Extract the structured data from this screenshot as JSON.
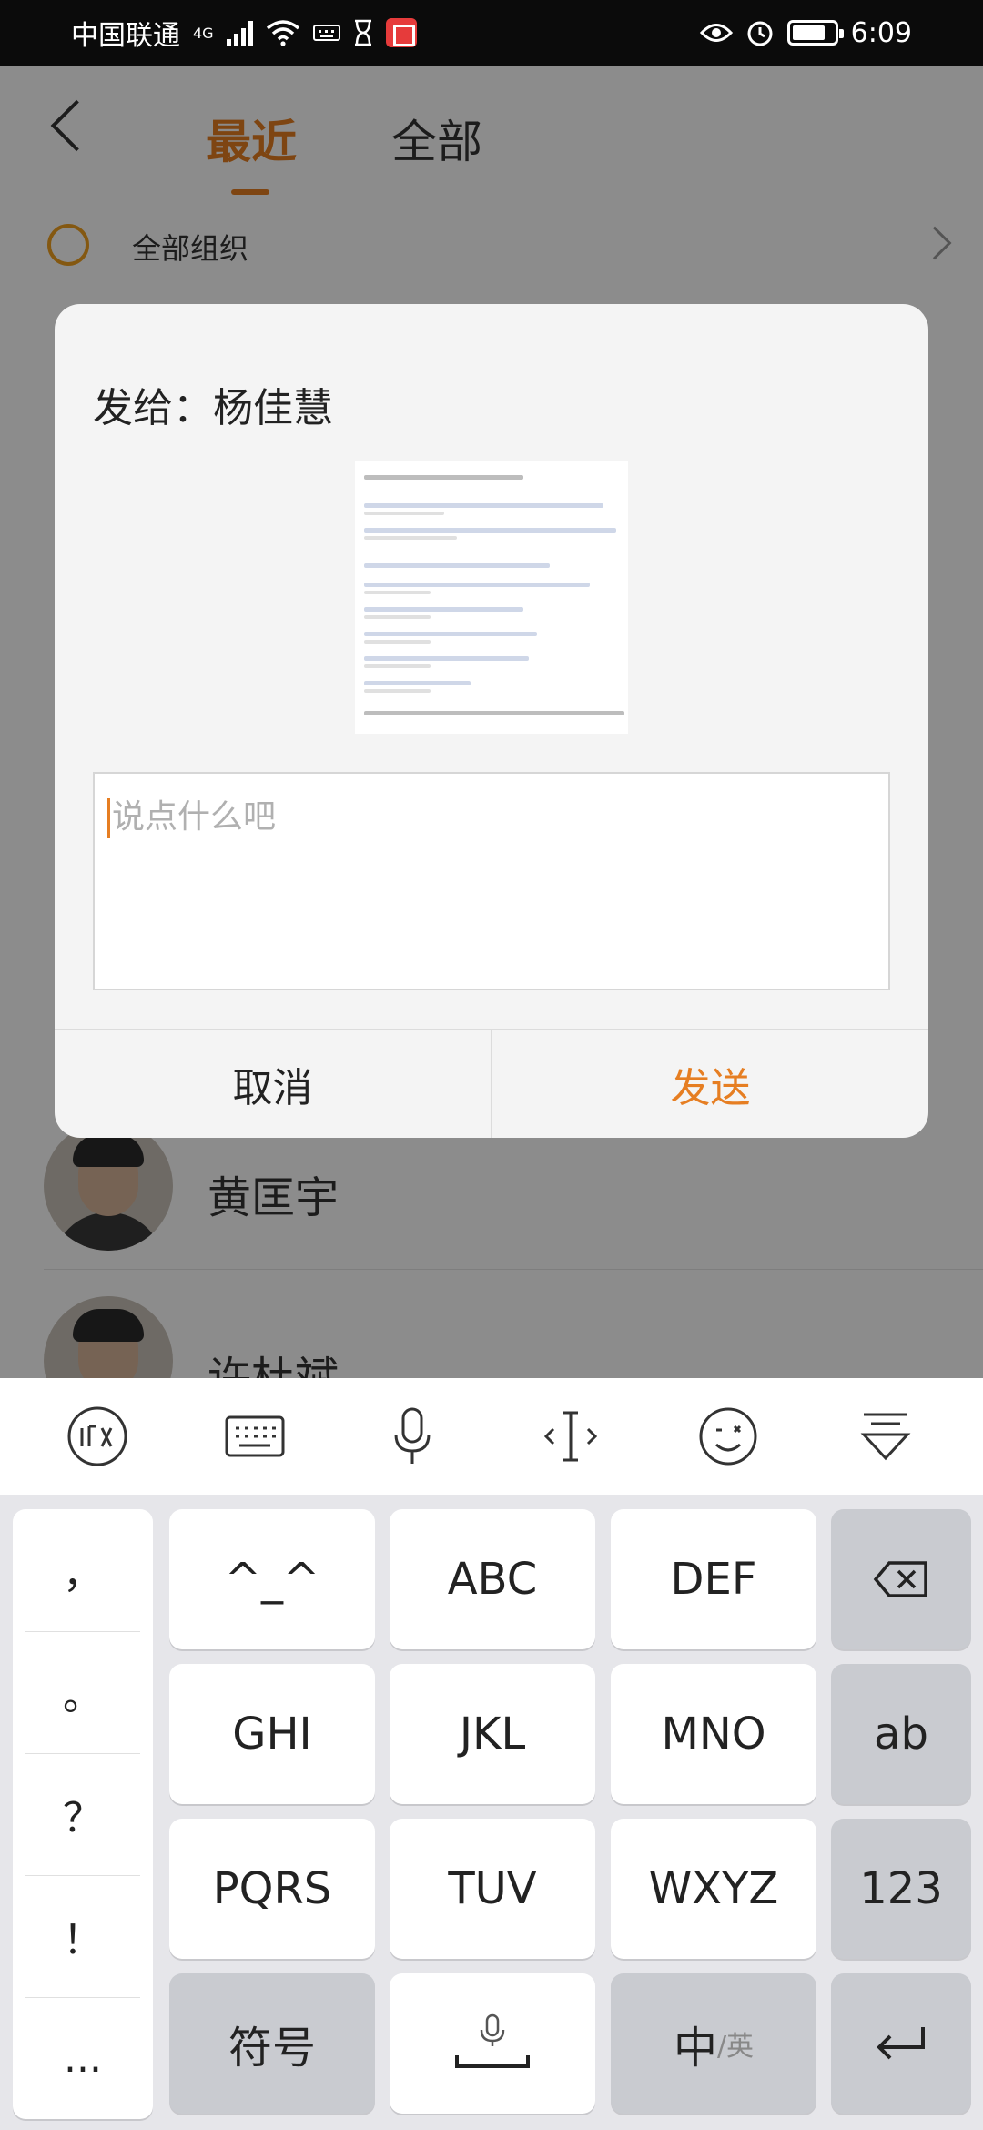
{
  "statusbar": {
    "carrier": "中国联通",
    "network": "4G",
    "time": "6:09"
  },
  "nav": {
    "tabs": [
      {
        "label": "最近",
        "active": true
      },
      {
        "label": "全部",
        "active": false
      }
    ]
  },
  "org": {
    "label": "全部组织"
  },
  "contacts": [
    {
      "name": "黄匡宇"
    },
    {
      "name": "许杜斌"
    }
  ],
  "dialog": {
    "title": "发给：杨佳慧",
    "message_placeholder": "说点什么吧",
    "cancel_label": "取消",
    "send_label": "发送"
  },
  "keyboard": {
    "punctuation": [
      "，",
      "。",
      "？",
      "！",
      "..."
    ],
    "rows": [
      [
        "^_^",
        "ABC",
        "DEF"
      ],
      [
        "GHI",
        "JKL",
        "MNO"
      ],
      [
        "PQRS",
        "TUV",
        "WXYZ"
      ]
    ],
    "side_keys": {
      "row2": "ab",
      "row3": "123"
    },
    "symbol_label": "符号",
    "lang_main": "中",
    "lang_sub": "/英"
  },
  "colors": {
    "accent": "#e67e22",
    "statusbar": "#0b0b0b",
    "dialog_bg": "#f4f4f4",
    "keyboard_bg": "#e6e6ea"
  }
}
